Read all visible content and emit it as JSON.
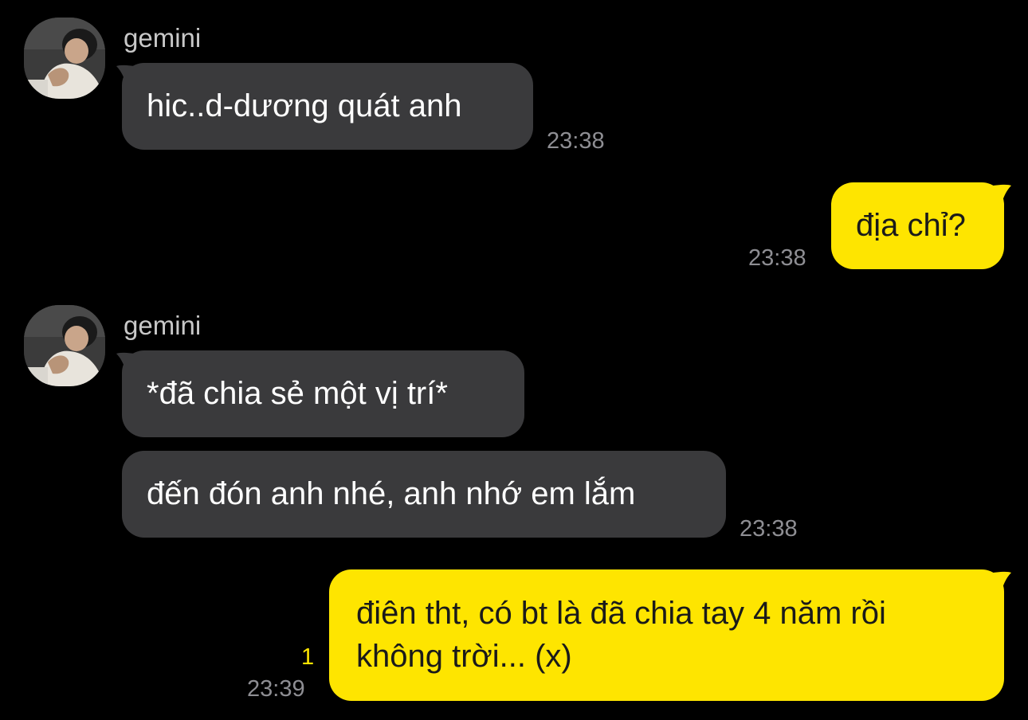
{
  "colors": {
    "background": "#000000",
    "incoming_bubble": "#3a3a3c",
    "outgoing_bubble": "#fee500",
    "timestamp": "#8e8e93",
    "unread_count": "#fee500"
  },
  "messages": [
    {
      "direction": "incoming",
      "sender": "gemini",
      "avatar_icon": "profile-photo-icon",
      "bubbles": [
        "hic..d-dương quát anh"
      ],
      "time": "23:38"
    },
    {
      "direction": "outgoing",
      "bubbles": [
        "địa chỉ?"
      ],
      "time": "23:38"
    },
    {
      "direction": "incoming",
      "sender": "gemini",
      "avatar_icon": "profile-photo-icon",
      "bubbles": [
        "*đã chia sẻ một vị trí*",
        "đến đón anh nhé, anh nhớ em lắm"
      ],
      "time": "23:38"
    },
    {
      "direction": "outgoing",
      "bubbles": [
        "điên tht, có bt là đã chia tay 4 năm rồi không trời... (x)"
      ],
      "unread": "1",
      "time": "23:39"
    }
  ]
}
